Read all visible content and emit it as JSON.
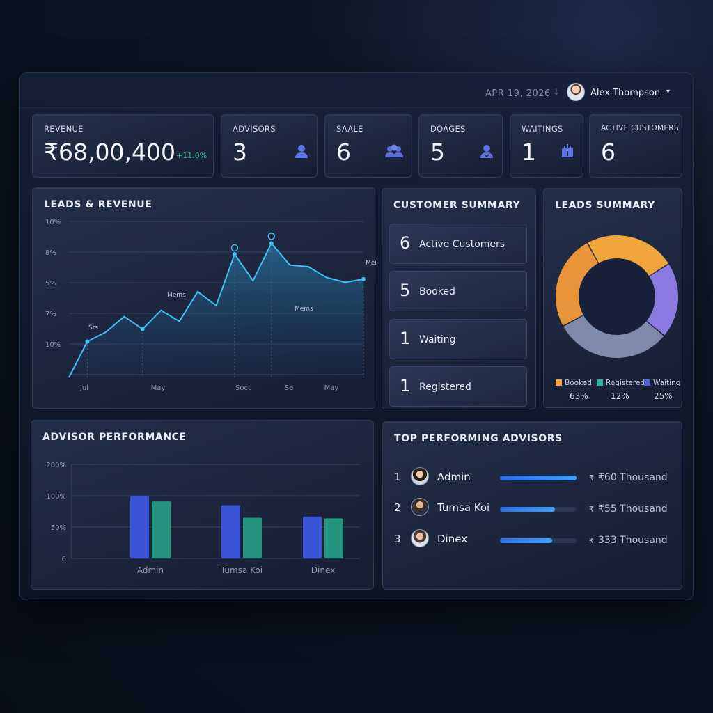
{
  "header": {
    "date": "APR 19, 2026",
    "separator": "↓",
    "user_name": "Alex Thompson",
    "caret": "▾"
  },
  "stats": [
    {
      "label": "REVENUE",
      "value": "₹68,00,400",
      "delta": "+11.0%",
      "icon": ""
    },
    {
      "label": "ADVISORS",
      "value": "3",
      "icon": "person-icon"
    },
    {
      "label": "SAALE",
      "value": "6",
      "icon": "group-icon"
    },
    {
      "label": "DOAGES",
      "value": "5",
      "icon": "user-badge-icon"
    },
    {
      "label": "WAITINGS",
      "value": "1",
      "icon": "calendar-icon"
    },
    {
      "label": "ACTIVE CUSTOMERS",
      "value": "6",
      "icon": ""
    }
  ],
  "leads_revenue": {
    "title": "LEADS & REVENUE",
    "annotations": [
      "Mems",
      "Mems",
      "Mems",
      "Sts"
    ]
  },
  "customer_summary": {
    "title": "CUSTOMER SUMMARY",
    "rows": [
      {
        "num": "6",
        "label": "Active Customers"
      },
      {
        "num": "5",
        "label": "Booked"
      },
      {
        "num": "1",
        "label": "Waiting"
      },
      {
        "num": "1",
        "label": "Registered"
      }
    ]
  },
  "leads_summary": {
    "title": "LEADS SUMMARY",
    "legend": [
      {
        "label": "Booked",
        "pct": "63%",
        "color": "#f0a63a"
      },
      {
        "label": "Registered",
        "pct": "12%",
        "color": "#2bb59a"
      },
      {
        "label": "Waiting",
        "pct": "25%",
        "color": "#4e63d9"
      }
    ]
  },
  "advisor_performance": {
    "title": "ADVISOR PERFORMANCE"
  },
  "top_advisors": {
    "title": "TOP PERFORMING ADVISORS",
    "rows": [
      {
        "rank": "1",
        "name": "Admin",
        "amount": "₹60 Thousand",
        "currency": "₹",
        "progress": 1.0
      },
      {
        "rank": "2",
        "name": "Tumsa Koi",
        "amount": "₹55 Thousand",
        "currency": "₹",
        "progress": 0.72
      },
      {
        "rank": "3",
        "name": "Dinex",
        "amount": "333 Thousand",
        "currency": "₹",
        "progress": 0.68
      }
    ]
  },
  "chart_data": [
    {
      "type": "area",
      "title": "LEADS & REVENUE",
      "y_ticks": [
        "10%",
        "8%",
        "5%",
        "7%",
        "10%"
      ],
      "x_ticks": [
        "Jul",
        "May",
        "Soct",
        "Se",
        "May"
      ],
      "x": [
        0,
        1,
        2,
        3,
        4,
        5,
        6,
        7,
        8,
        9,
        10,
        11,
        12,
        13,
        14,
        15,
        16
      ],
      "values": [
        0,
        2.3,
        2.9,
        3.9,
        3.1,
        4.3,
        3.6,
        5.5,
        4.6,
        7.9,
        6.2,
        8.6,
        7.2,
        7.1,
        6.4,
        6.1,
        6.3
      ],
      "markers": [
        1,
        4,
        9,
        11,
        16
      ],
      "ylim": [
        0,
        10
      ],
      "grid": true,
      "color": "#3ec2f4"
    },
    {
      "type": "pie",
      "title": "LEADS SUMMARY",
      "labels": [
        "Booked",
        "Registered",
        "Waiting"
      ],
      "segments_shown": [
        {
          "color": "#f0a63a",
          "value": 24
        },
        {
          "color": "#8d7ae0",
          "value": 20
        },
        {
          "color": "#7e8baa",
          "value": 31
        },
        {
          "color": "#e8953a",
          "value": 25
        }
      ],
      "legend_values": [
        63,
        12,
        25
      ]
    },
    {
      "type": "bar",
      "title": "ADVISOR PERFORMANCE",
      "categories": [
        "Admin",
        "Tumsa Koi",
        "Dinex"
      ],
      "y_ticks": [
        "200%",
        "100%",
        "50%",
        "0"
      ],
      "series": [
        {
          "values": [
            100,
            85,
            67
          ],
          "color": "#3b53d6"
        },
        {
          "values": [
            91,
            65,
            64
          ],
          "color": "#25957f"
        }
      ],
      "ylim": [
        0,
        200
      ]
    }
  ]
}
